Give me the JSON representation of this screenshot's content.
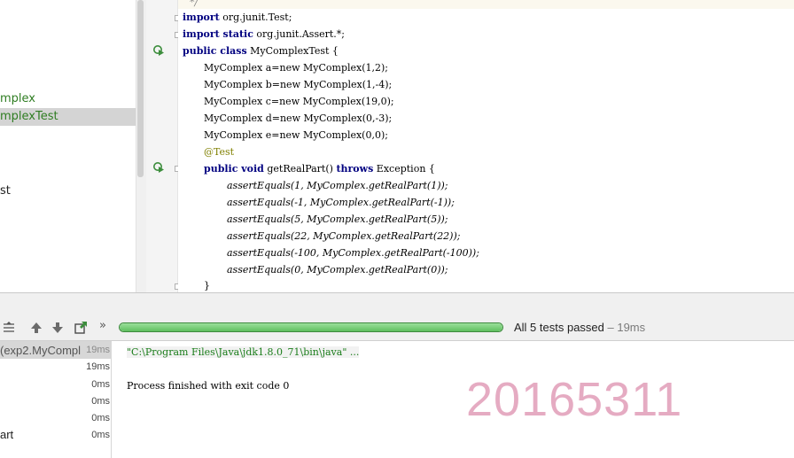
{
  "project_tree": {
    "items": [
      {
        "label": "mplex",
        "style": "green"
      },
      {
        "label": "mplexTest",
        "style": "green",
        "selected": true
      },
      {
        "label": "st",
        "style": "dark"
      }
    ]
  },
  "editor": {
    "comment_end": "*/",
    "lines": {
      "import1_kw": "import",
      "import1_rest": " org.junit.Test;",
      "import2_kw": "import static",
      "import2_rest": " org.junit.Assert.*;",
      "class_kw": "public class",
      "class_rest": " MyComplexTest {",
      "decl_a": "MyComplex a=new MyComplex(1,2);",
      "decl_b": "MyComplex b=new MyComplex(1,-4);",
      "decl_c": "MyComplex c=new MyComplex(19,0);",
      "decl_d": "MyComplex d=new MyComplex(0,-3);",
      "decl_e": "MyComplex e=new MyComplex(0,0);",
      "annotation": "@Test",
      "method_kw": "public void",
      "method_name": " getRealPart() ",
      "throws_kw": "throws",
      "method_rest": " Exception {",
      "assert1": "assertEquals(1, MyComplex.getRealPart(1));",
      "assert2": "assertEquals(-1, MyComplex.getRealPart(-1));",
      "assert3": "assertEquals(5, MyComplex.getRealPart(5));",
      "assert4": "assertEquals(22, MyComplex.getRealPart(22));",
      "assert5": "assertEquals(-100, MyComplex.getRealPart(-100));",
      "assert6": "assertEquals(0, MyComplex.getRealPart(0));",
      "close_brace": "}"
    }
  },
  "run_panel": {
    "more_label": "»",
    "progress_fraction": 1.0,
    "status": "All 5 tests passed",
    "status_time": " – 19ms",
    "results": [
      {
        "name": "(exp2.MyCompl",
        "time": "19ms"
      },
      {
        "name": "",
        "time": "19ms"
      },
      {
        "name": "",
        "time": "0ms"
      },
      {
        "name": "",
        "time": "0ms"
      },
      {
        "name": "",
        "time": "0ms"
      },
      {
        "name": "art",
        "time": "0ms"
      }
    ],
    "console": {
      "command": "\"C:\\Program Files\\Java\\jdk1.8.0_71\\bin\\java\" ...",
      "finished": "Process finished with exit code 0"
    }
  },
  "watermark": "20165311",
  "colors": {
    "green_text": "#2f7d22",
    "keyword": "#000080",
    "progress_green": "#5fbf5f",
    "watermark_pink": "#e3a3bc"
  }
}
